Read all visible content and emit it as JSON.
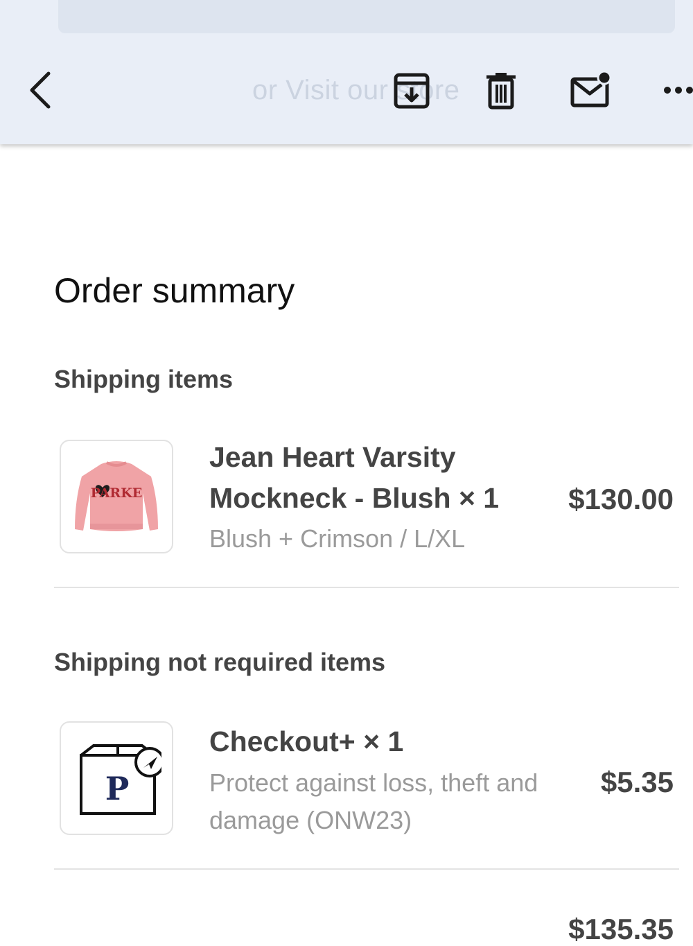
{
  "toolbar": {
    "ghost_text": "or Visit our store",
    "icons": [
      "back-chevron-icon",
      "archive-icon",
      "trash-icon",
      "mail-unread-icon",
      "more-icon"
    ]
  },
  "order": {
    "title": "Order summary",
    "shipping_heading": "Shipping items",
    "items": [
      {
        "name": "Jean Heart Varsity Mockneck - Blush × 1",
        "variant": "Blush + Crimson / L/XL",
        "price": "$130.00",
        "image": "pink-sweater-image",
        "image_text": "PARKE"
      }
    ],
    "no_shipping_heading": "Shipping not required items",
    "digital_items": [
      {
        "name": "Checkout+ × 1",
        "description": "Protect against loss, theft and damage (ONW23)",
        "price": "$5.35",
        "image": "package-protection-icon",
        "image_text": "P"
      }
    ],
    "subtotal_peek": "$135.35"
  },
  "colors": {
    "toolbar_bg": "#e9eef7",
    "text_primary": "#444444",
    "text_secondary": "#9a9a9a",
    "sweater_pink": "#f0a3a6",
    "crimson": "#b02a32",
    "navy": "#1f2a5a"
  }
}
